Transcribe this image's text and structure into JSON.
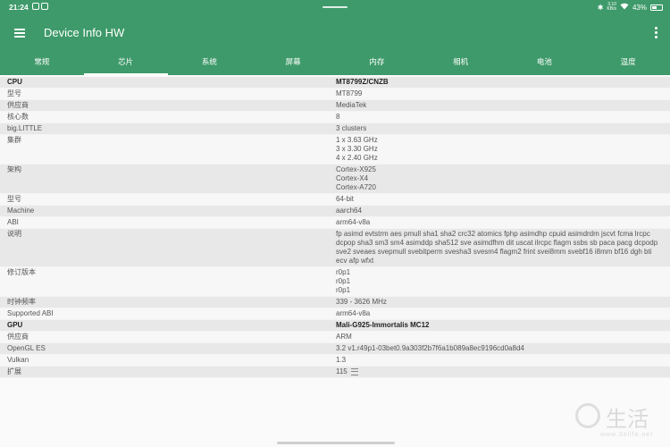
{
  "status_bar": {
    "time": "21:24",
    "net_speed_top": "3.10",
    "net_speed_bottom": "KB/s",
    "battery": "43%"
  },
  "app_bar": {
    "title": "Device Info HW"
  },
  "tabs": [
    {
      "label": "常规",
      "active": false
    },
    {
      "label": "芯片",
      "active": true
    },
    {
      "label": "系统",
      "active": false
    },
    {
      "label": "屏幕",
      "active": false
    },
    {
      "label": "内存",
      "active": false
    },
    {
      "label": "相机",
      "active": false
    },
    {
      "label": "电池",
      "active": false
    },
    {
      "label": "温度",
      "active": false
    }
  ],
  "rows": [
    {
      "label": "CPU",
      "value": "MT8799Z/CNZB",
      "bold": true
    },
    {
      "label": "型号",
      "value": "MT8799"
    },
    {
      "label": "供应商",
      "value": "MediaTek"
    },
    {
      "label": "核心数",
      "value": "8"
    },
    {
      "label": "big.LITTLE",
      "value": "3 clusters"
    },
    {
      "label": "集群",
      "value": "1 x 3.63 GHz\n3 x 3.30 GHz\n4 x 2.40 GHz"
    },
    {
      "label": "架构",
      "value": "Cortex-X925\nCortex-X4\nCortex-A720"
    },
    {
      "label": "型号",
      "value": "64-bit"
    },
    {
      "label": "Machine",
      "value": "aarch64"
    },
    {
      "label": "ABI",
      "value": "arm64-v8a"
    },
    {
      "label": "说明",
      "value": "fp asimd evtstrm aes pmull sha1 sha2 crc32 atomics fphp asimdhp cpuid asimdrdm jscvt fcma lrcpc dcpop sha3 sm3 sm4 asimddp sha512 sve asimdfhm dit uscat ilrcpc flagm ssbs sb paca pacg dcpodp sve2 sveaes svepmull svebitperm svesha3 svesm4 flagm2 frint svei8mm svebf16 i8mm bf16 dgh bti ecv afp wfxt"
    },
    {
      "label": "修订版本",
      "value": "r0p1\nr0p1\nr0p1"
    },
    {
      "label": "时钟频率",
      "value": "339 - 3626 MHz"
    },
    {
      "label": "Supported ABI",
      "value": "arm64-v8a"
    },
    {
      "label": "GPU",
      "value": "Mali-G925-Immortalis MC12",
      "bold": true
    },
    {
      "label": "供应商",
      "value": "ARM"
    },
    {
      "label": "OpenGL ES",
      "value": "3.2 v1.r49p1-03bet0.9a303f2b7f6a1b089a8ec9196cd0a8d4"
    },
    {
      "label": "Vulkan",
      "value": "1.3"
    },
    {
      "label": "扩展",
      "value": "115",
      "icon": "list-icon"
    }
  ],
  "watermark": {
    "text": "生活",
    "url": "www.3elife.net"
  }
}
